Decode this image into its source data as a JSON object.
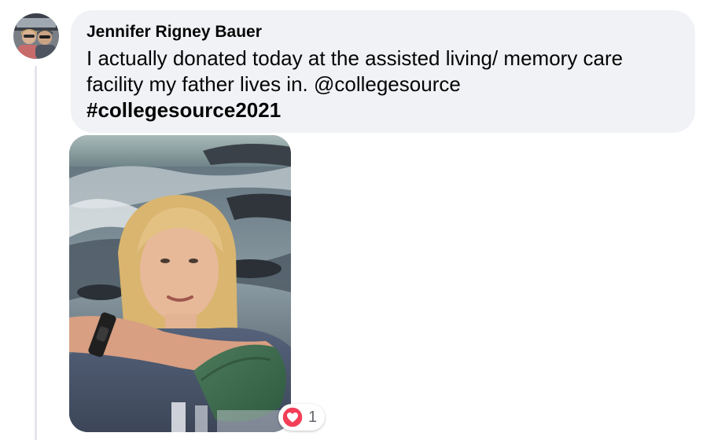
{
  "comment": {
    "author": "Jennifer Rigney Bauer",
    "text_line1": "I actually donated today at the assisted living/ memory care",
    "text_line2_prefix": "facility my father lives in. ",
    "mention": "@collegesource",
    "hashtag": "#collegesource2021"
  },
  "reactions": {
    "icon": "love-heart-icon",
    "count": "1"
  },
  "colors": {
    "bubble_bg": "#f0f2f5",
    "love_red": "#f33e58",
    "meta_text": "#65676b"
  }
}
